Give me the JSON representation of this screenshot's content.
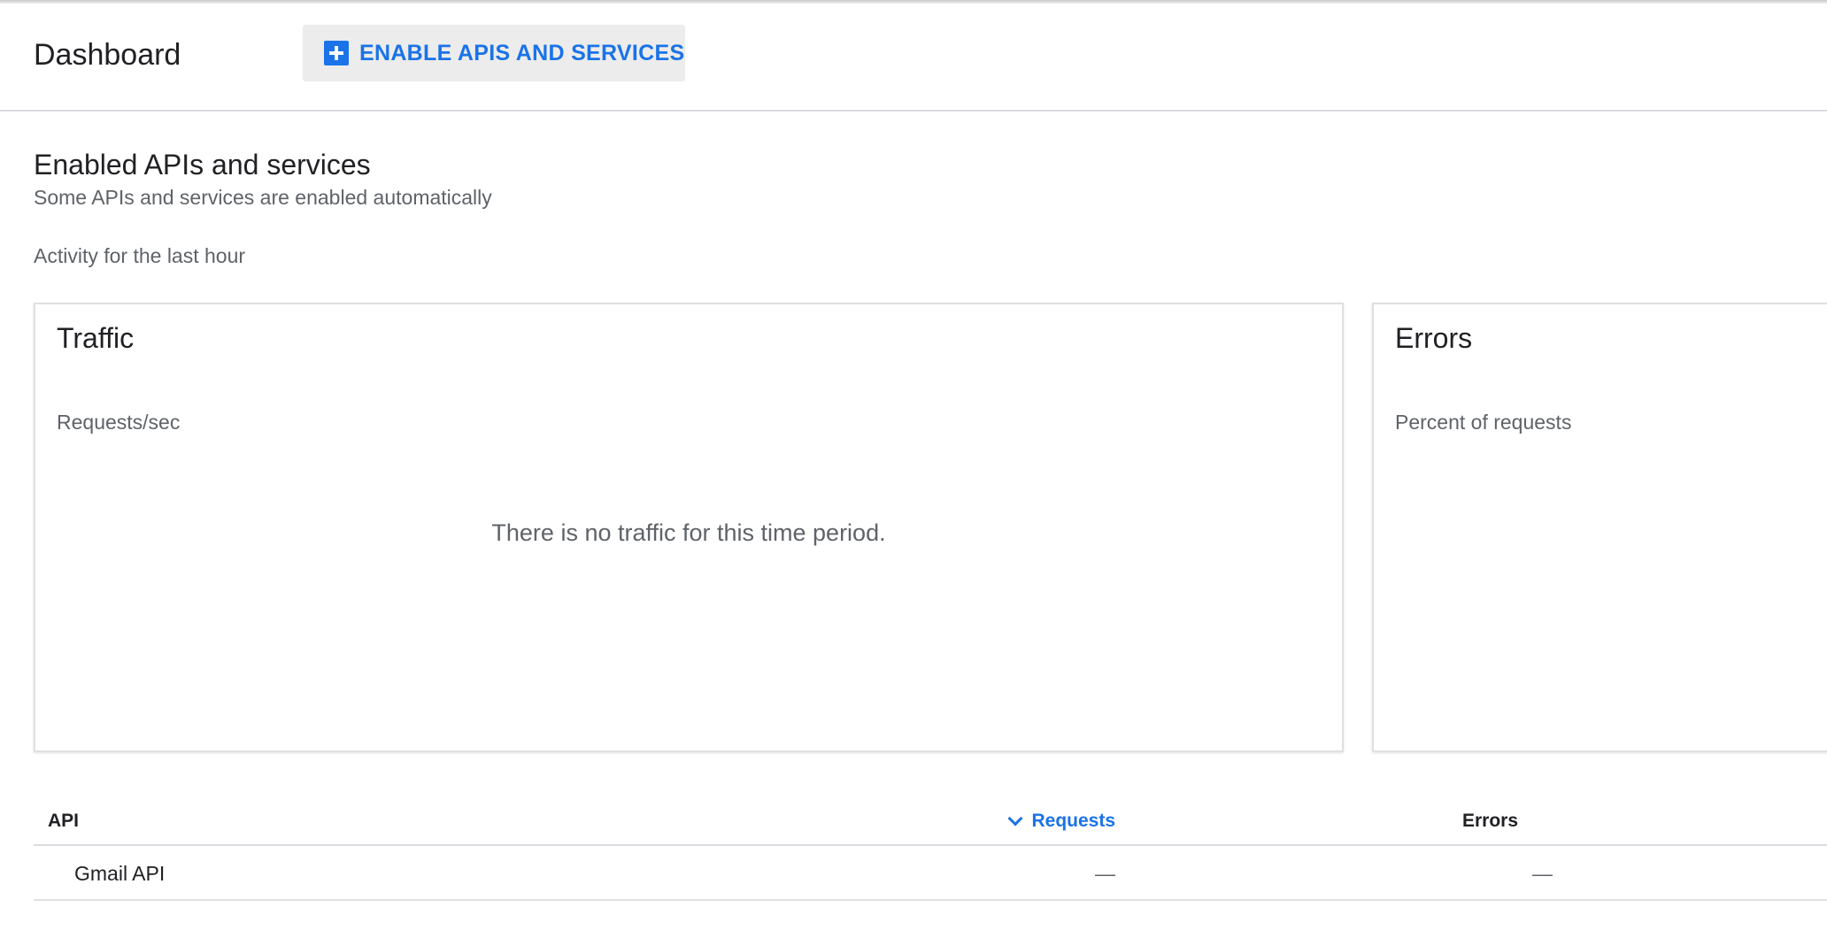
{
  "header": {
    "title": "Dashboard",
    "enable_button_label": "ENABLE APIS AND SERVICES",
    "enable_button_icon": "add-box-icon"
  },
  "section": {
    "title": "Enabled APIs and services",
    "subtitle": "Some APIs and services are enabled automatically",
    "activity_label": "Activity for the last hour"
  },
  "cards": {
    "traffic": {
      "title": "Traffic",
      "subtitle": "Requests/sec",
      "empty_message": "There is no traffic for this time period."
    },
    "errors": {
      "title": "Errors",
      "subtitle": "Percent of requests"
    }
  },
  "table": {
    "columns": {
      "api": "API",
      "requests": "Requests",
      "errors": "Errors"
    },
    "sort_indicator": "chevron-down-icon",
    "rows": [
      {
        "api": "Gmail API",
        "requests": "—",
        "errors": "—"
      }
    ]
  },
  "colors": {
    "accent": "#1a73e8",
    "button_bg": "#ececec",
    "divider": "#dadce0",
    "secondary_text": "#5f6368"
  }
}
